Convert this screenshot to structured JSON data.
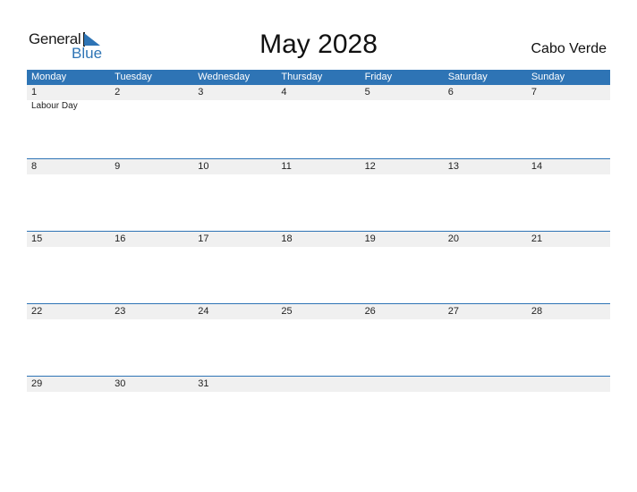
{
  "logo": {
    "general": "General",
    "blue": "Blue"
  },
  "header": {
    "title": "May 2028",
    "country": "Cabo Verde"
  },
  "days": [
    "Monday",
    "Tuesday",
    "Wednesday",
    "Thursday",
    "Friday",
    "Saturday",
    "Sunday"
  ],
  "weeks": [
    {
      "dates": [
        "1",
        "2",
        "3",
        "4",
        "5",
        "6",
        "7"
      ],
      "events": [
        "Labour Day",
        "",
        "",
        "",
        "",
        "",
        ""
      ]
    },
    {
      "dates": [
        "8",
        "9",
        "10",
        "11",
        "12",
        "13",
        "14"
      ],
      "events": [
        "",
        "",
        "",
        "",
        "",
        "",
        ""
      ]
    },
    {
      "dates": [
        "15",
        "16",
        "17",
        "18",
        "19",
        "20",
        "21"
      ],
      "events": [
        "",
        "",
        "",
        "",
        "",
        "",
        ""
      ]
    },
    {
      "dates": [
        "22",
        "23",
        "24",
        "25",
        "26",
        "27",
        "28"
      ],
      "events": [
        "",
        "",
        "",
        "",
        "",
        "",
        ""
      ]
    },
    {
      "dates": [
        "29",
        "30",
        "31",
        "",
        "",
        "",
        ""
      ],
      "events": [
        "",
        "",
        "",
        "",
        "",
        "",
        ""
      ]
    }
  ],
  "colors": {
    "accent": "#2e74b5",
    "date_strip": "#f0f0f0"
  }
}
